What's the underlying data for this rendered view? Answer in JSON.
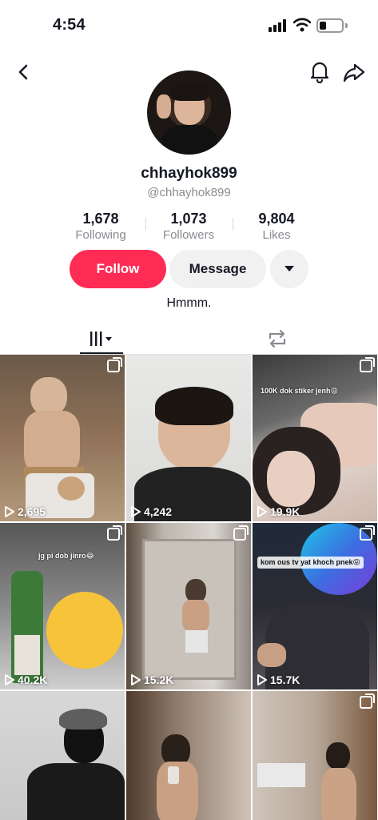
{
  "status_bar": {
    "time": "4:54"
  },
  "profile": {
    "username": "chhayhok899",
    "handle": "@chhayhok899",
    "bio": "Hmmm."
  },
  "stats": {
    "following": {
      "value": "1,678",
      "label": "Following"
    },
    "followers": {
      "value": "1,073",
      "label": "Followers"
    },
    "likes": {
      "value": "9,804",
      "label": "Likes"
    }
  },
  "actions": {
    "follow_label": "Follow",
    "message_label": "Message"
  },
  "colors": {
    "accent": "#fe2c55",
    "secondary_button": "#f1f1f2",
    "muted_text": "#8a8b91"
  },
  "icons": {
    "back": "chevron-left-icon",
    "bell": "bell-icon",
    "share": "share-icon",
    "more": "caret-down-icon",
    "videos_tab": "grid-icon",
    "reposts_tab": "repost-icon",
    "play": "play-icon"
  },
  "videos": [
    {
      "views": "2,695",
      "caption": ""
    },
    {
      "views": "4,242",
      "caption": ""
    },
    {
      "views": "19.9K",
      "caption": "100K dok stiker jenh😩"
    },
    {
      "views": "40.2K",
      "caption": "jg pi dob jinro😂"
    },
    {
      "views": "15.2K",
      "caption": ""
    },
    {
      "views": "15.7K",
      "caption": "kom ous tv yat khoch pnek😝"
    },
    {
      "views": "",
      "caption": ""
    },
    {
      "views": "",
      "caption": ""
    },
    {
      "views": "",
      "caption": ""
    }
  ]
}
